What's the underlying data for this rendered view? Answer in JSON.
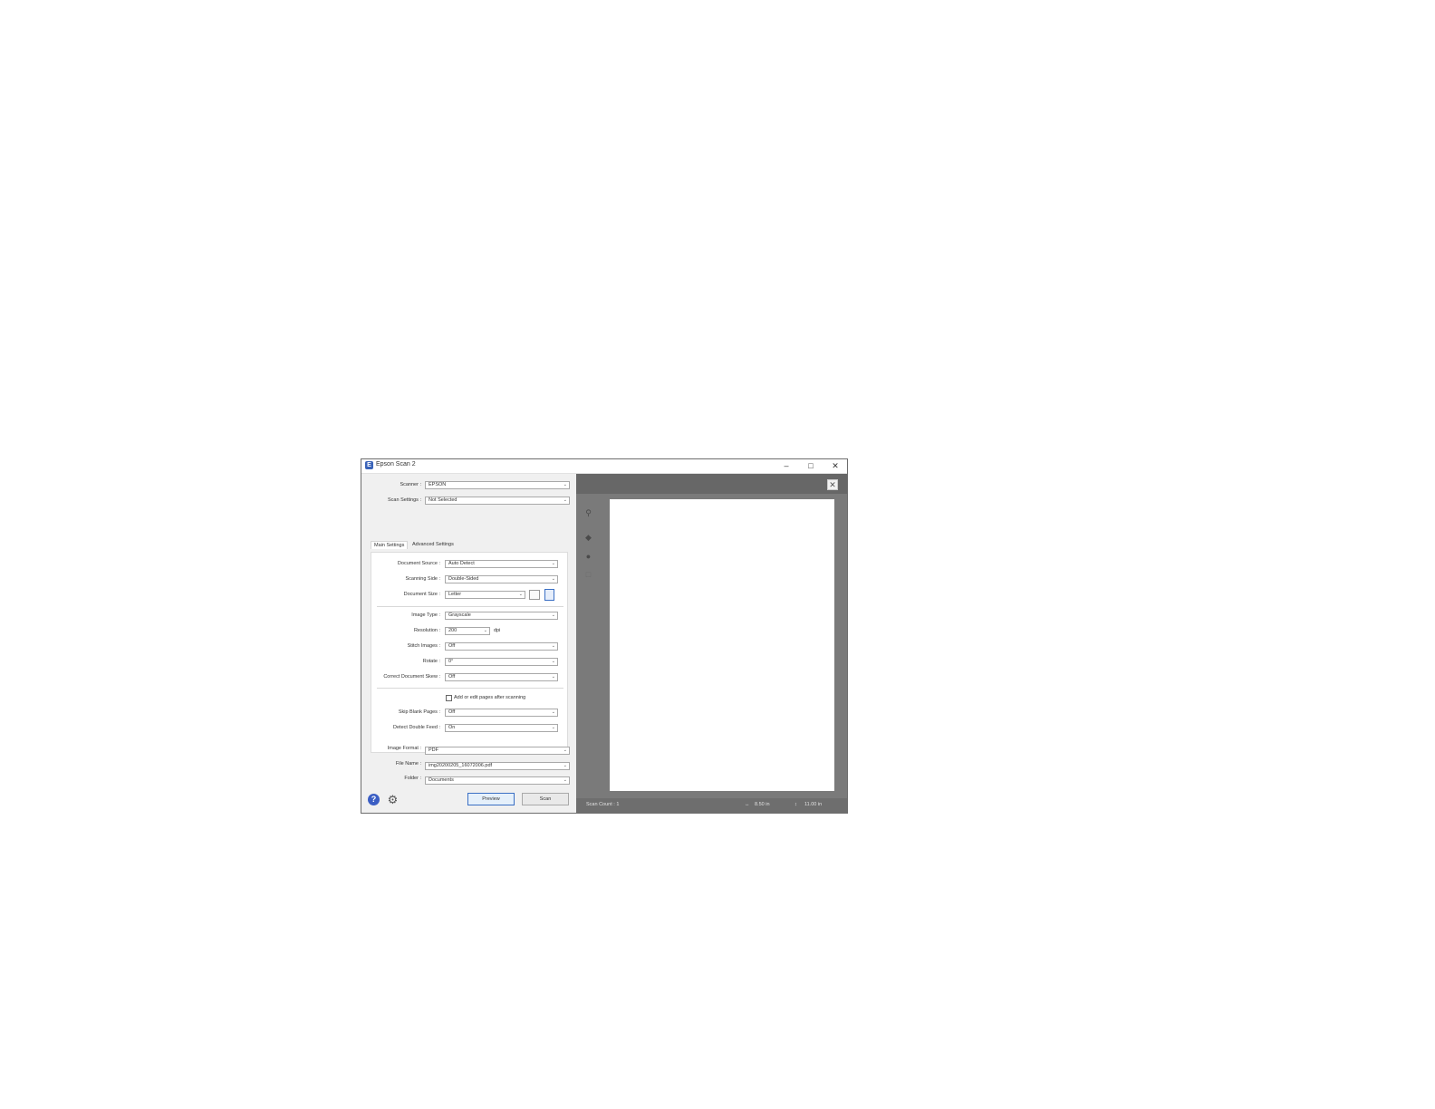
{
  "window": {
    "title": "Epson Scan 2",
    "minimize": "–",
    "maximize": "□",
    "close": "✕"
  },
  "top_fields": {
    "scanner": {
      "label": "Scanner :",
      "value": "EPSON"
    },
    "scan_settings": {
      "label": "Scan Settings :",
      "value": "Not Selected"
    }
  },
  "tabs": [
    {
      "label": "Main Settings",
      "active": true
    },
    {
      "label": "Advanced Settings",
      "active": false
    }
  ],
  "main_settings": {
    "document_source": {
      "label": "Document Source :",
      "value": "Auto Detect"
    },
    "scanning_side": {
      "label": "Scanning Side :",
      "value": "Double-Sided"
    },
    "document_size": {
      "label": "Document Size :",
      "value": "Letter"
    },
    "image_type": {
      "label": "Image Type :",
      "value": "Grayscale"
    },
    "resolution": {
      "label": "Resolution :",
      "value": "200",
      "unit": "dpi"
    },
    "stitch_images": {
      "label": "Stitch Images :",
      "value": "Off"
    },
    "rotate": {
      "label": "Rotate :",
      "value": "0°"
    },
    "correct_skew": {
      "label": "Correct Document Skew :",
      "value": "Off"
    },
    "add_edit_pages": {
      "label": "Add or edit pages after scanning",
      "checked": false
    },
    "skip_blank": {
      "label": "Skip Blank Pages :",
      "value": "Off"
    },
    "detect_double_feed": {
      "label": "Detect Double Feed :",
      "value": "On"
    }
  },
  "output": {
    "image_format": {
      "label": "Image Format :",
      "value": "PDF"
    },
    "file_name": {
      "label": "File Name :",
      "value": "img20200205_16072006.pdf"
    },
    "folder": {
      "label": "Folder :",
      "value": "Documents"
    }
  },
  "buttons": {
    "preview": "Preview",
    "scan": "Scan"
  },
  "preview_pane": {
    "close": "✕",
    "scan_count": "Scan Count : 1",
    "width": "8.50 in",
    "height": "11.00 in"
  },
  "icons": {
    "help": "?",
    "gear": "⚙",
    "zoom": "⚲",
    "rotate": "◆",
    "settings": "●",
    "crop": "□"
  },
  "colors": {
    "accent": "#3a6fc4",
    "preview_bg": "#7a7a7a"
  }
}
